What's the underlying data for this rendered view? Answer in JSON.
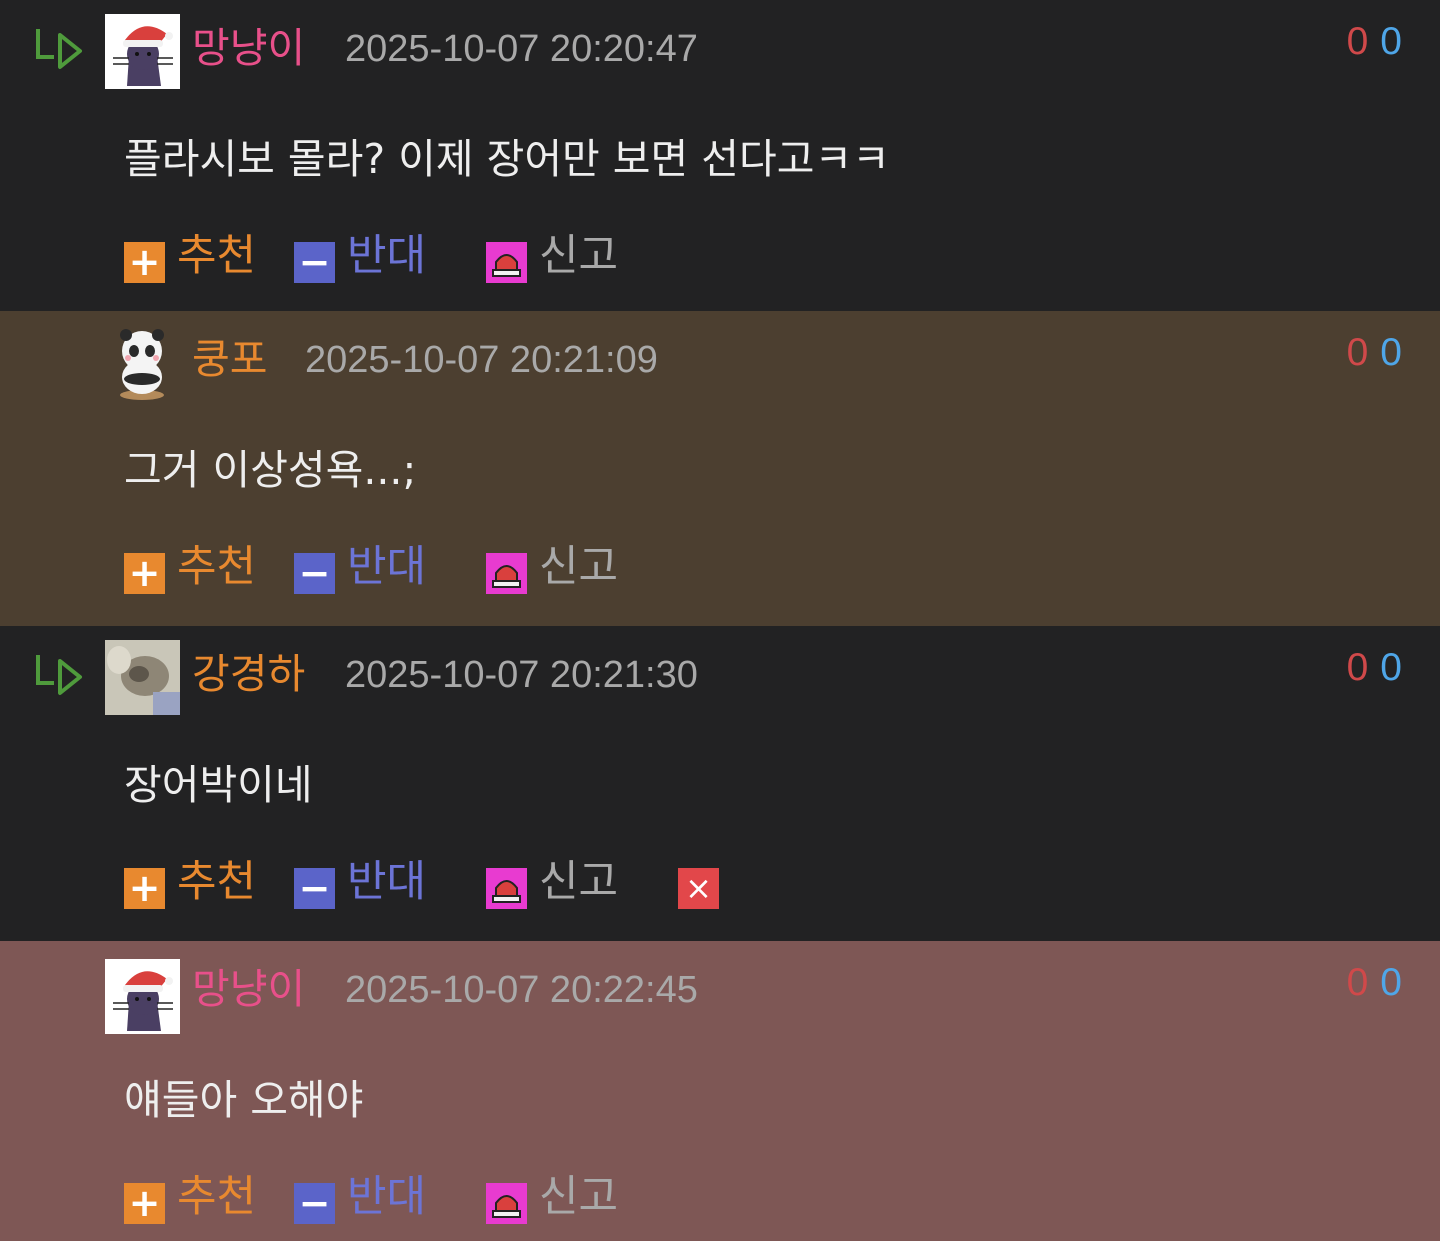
{
  "colors": {
    "page_background": "#222223",
    "highlight_brown": "#4c3f30",
    "highlight_red": "#7e5755",
    "nick_pink": "#e8508a",
    "nick_orange": "#e8892f",
    "recommend_orange": "#e8892f",
    "oppose_blue": "#5b64c9",
    "report_magenta": "#e83bd0",
    "delete_red": "#e2474a",
    "score_up_red": "#d0494a",
    "score_down_blue": "#4fa6e8",
    "reply_arrow_green": "#4f9b3c"
  },
  "actions": {
    "recommend_label": "추천",
    "recommend_icon": "+",
    "oppose_label": "반대",
    "oppose_icon": "−",
    "report_label": "신고",
    "delete_icon": "×"
  },
  "comments": [
    {
      "is_reply": true,
      "avatar": "cat-santa-avatar",
      "nickname": "망냥이",
      "nickname_color": "#e8508a",
      "timestamp": "2025-10-07 20:20:47",
      "score_up": "0",
      "score_down": "0",
      "text": "플라시보 몰라? 이제 장어만 보면 선다고ㅋㅋ",
      "background": "#222223",
      "can_delete": false
    },
    {
      "is_reply": false,
      "avatar": "panda-avatar",
      "nickname": "쿵포",
      "nickname_color": "#e8892f",
      "timestamp": "2025-10-07 20:21:09",
      "score_up": "0",
      "score_down": "0",
      "text": "그거 이상성욕...;",
      "background": "#4c3f30",
      "can_delete": false
    },
    {
      "is_reply": true,
      "avatar": "blurred-photo-avatar",
      "nickname": "강경하",
      "nickname_color": "#e8892f",
      "timestamp": "2025-10-07 20:21:30",
      "score_up": "0",
      "score_down": "0",
      "text": "장어박이네",
      "background": "#222223",
      "can_delete": true
    },
    {
      "is_reply": false,
      "avatar": "cat-santa-avatar",
      "nickname": "망냥이",
      "nickname_color": "#e8508a",
      "timestamp": "2025-10-07 20:22:45",
      "score_up": "0",
      "score_down": "0",
      "text": "얘들아 오해야",
      "background": "#7e5755",
      "can_delete": false
    }
  ]
}
